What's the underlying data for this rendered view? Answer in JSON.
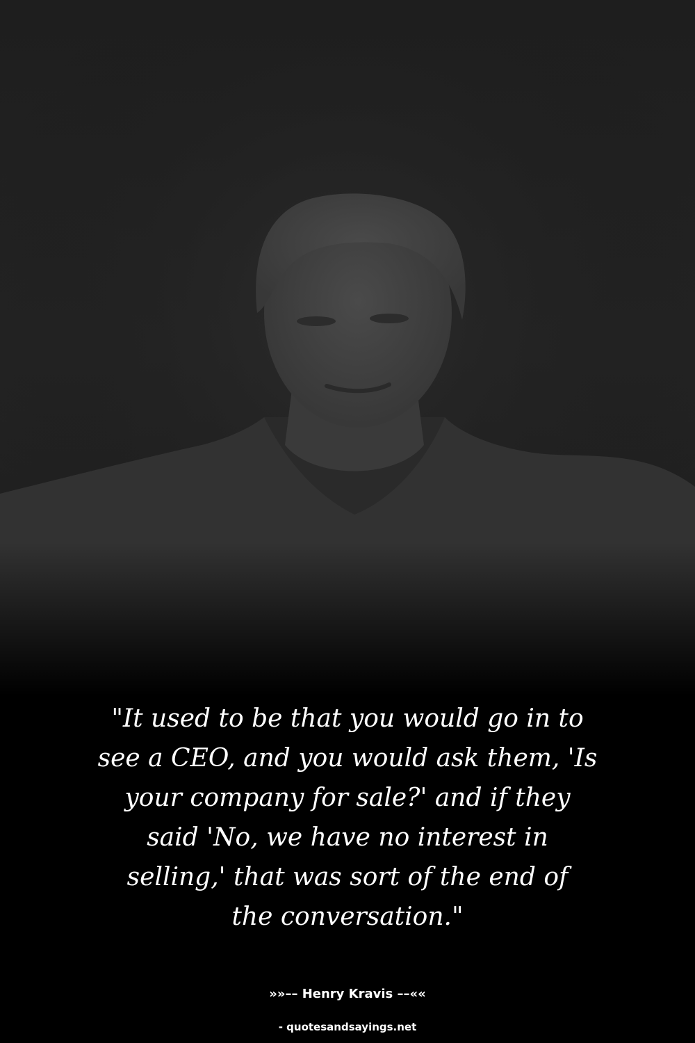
{
  "quote": {
    "text": "\"It used to be that you would go in to\nsee a CEO, and you would ask them, 'Is\nyour company for sale?' and if they\nsaid 'No, we have no interest in\nselling,' that was sort of the end of\nthe conversation.\""
  },
  "attribution": {
    "author_line": "»»–– Henry Kravis ––««"
  },
  "footer": {
    "site": "- quotesandsayings.net"
  },
  "colors": {
    "background": "#000000",
    "text": "#ffffff",
    "photo_tone": "#3a3a3a"
  }
}
